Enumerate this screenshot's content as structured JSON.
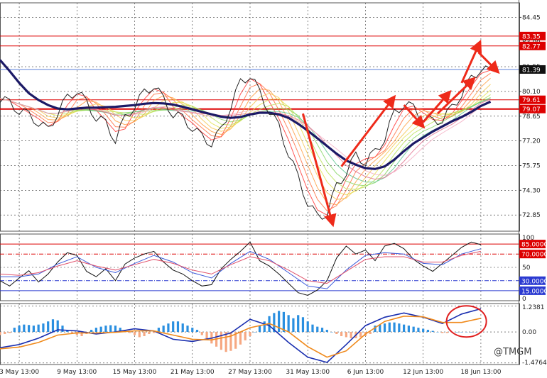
{
  "colors": {
    "background": "#ffffff",
    "grid": "#333333",
    "price_line": "#222222",
    "level_line": "#dd0000",
    "current_line": "#5a7fd8",
    "label_red": "#dd0000",
    "label_dark": "#111111",
    "slow_ma": "#1c1a66",
    "arrow": "#ee2a1a",
    "hist_pos": "#2a8fe0",
    "hist_neg": "#f6a882",
    "macd_line": "#1a2fb0",
    "signal_line": "#f08a1c",
    "rsi_main": "#111111",
    "rsi_blue": "#3b5bdb",
    "rsi_red": "#e0506a",
    "highlight_circle": "#e02020"
  },
  "watermark": "@TMGM",
  "chart_data": [
    {
      "type": "line",
      "panel": "price",
      "ylim": [
        71.9,
        85.3
      ],
      "y_ticks": [
        "84.45",
        "81.55",
        "80.10",
        "78.65",
        "77.20",
        "75.75",
        "74.30",
        "72.85"
      ],
      "x_tick_labels": [
        "3 May 13:00",
        "9 May 13:00",
        "15 May 13:00",
        "21 May 13:00",
        "27 May 13:00",
        "31 May 13:00",
        "6 Jun 13:00",
        "12 Jun 13:00",
        "18 Jun 13:00"
      ],
      "x_range": [
        0,
        100
      ],
      "x_ticks_at": [
        4,
        16,
        28,
        40,
        52,
        64,
        76,
        88,
        100
      ],
      "horizontal_levels": [
        {
          "value": 83.35,
          "label": "83.35",
          "style": "solid",
          "color_key": "level_line"
        },
        {
          "value": 83.0,
          "label": "83.00",
          "style": "none",
          "color_key": "label_dark"
        },
        {
          "value": 82.77,
          "label": "82.77",
          "style": "solid",
          "color_key": "level_line"
        },
        {
          "value": 81.39,
          "label": "81.39",
          "style": "solid",
          "color_key": "current_line",
          "current": true
        },
        {
          "value": 79.61,
          "label": "79.61",
          "style": "solid",
          "color_key": "level_line"
        },
        {
          "value": 79.07,
          "label": "79.07",
          "style": "solid",
          "color_key": "level_line",
          "bold": true
        }
      ],
      "series": [
        {
          "key": "price",
          "x": [
            0,
            2,
            4,
            6,
            8,
            10,
            12,
            14,
            16,
            18,
            20,
            22,
            24,
            26,
            28,
            30,
            32,
            34,
            36,
            38,
            40,
            42,
            44,
            46,
            48,
            50,
            52,
            54,
            56,
            58,
            60,
            62,
            64,
            66,
            68,
            70,
            72,
            74,
            76,
            78,
            80,
            82,
            84,
            86,
            88,
            90,
            92,
            94,
            96,
            98,
            100,
            102
          ],
          "values": [
            79.7,
            79.4,
            79.0,
            78.7,
            78.3,
            77.8,
            78.9,
            79.7,
            80.2,
            79.4,
            78.6,
            78.2,
            77.3,
            78.5,
            79.3,
            80.0,
            80.5,
            79.6,
            78.8,
            78.5,
            78.0,
            77.4,
            77.1,
            77.8,
            79.3,
            80.6,
            81.1,
            80.0,
            79.0,
            78.0,
            76.5,
            75.0,
            73.6,
            72.7,
            73.0,
            74.5,
            75.4,
            76.3,
            76.0,
            76.5,
            77.4,
            78.8,
            79.4,
            79.1,
            78.6,
            78.3,
            78.5,
            79.1,
            80.0,
            80.8,
            81.5,
            81.2
          ]
        },
        {
          "key": "slow_ma",
          "x": [
            0,
            2,
            4,
            6,
            8,
            10,
            12,
            14,
            16,
            18,
            20,
            22,
            24,
            26,
            28,
            30,
            32,
            34,
            36,
            38,
            40,
            42,
            44,
            46,
            48,
            50,
            52,
            54,
            56,
            58,
            60,
            62,
            64,
            66,
            68,
            70,
            72,
            74,
            76,
            78,
            80,
            82,
            84,
            86,
            88,
            90,
            92,
            94,
            96,
            98,
            100,
            102
          ],
          "values": [
            81.95,
            81.3,
            80.6,
            80.0,
            79.6,
            79.3,
            79.1,
            79.05,
            79.1,
            79.15,
            79.15,
            79.18,
            79.2,
            79.25,
            79.3,
            79.38,
            79.42,
            79.4,
            79.33,
            79.2,
            79.05,
            78.9,
            78.76,
            78.62,
            78.55,
            78.6,
            78.75,
            78.85,
            78.85,
            78.75,
            78.55,
            78.2,
            77.8,
            77.35,
            76.9,
            76.45,
            76.05,
            75.8,
            75.6,
            75.55,
            75.7,
            76.1,
            76.6,
            77.05,
            77.4,
            77.75,
            78.05,
            78.35,
            78.6,
            78.9,
            79.25,
            79.5
          ]
        }
      ],
      "ma_ribbon": true,
      "arrows": [
        {
          "from": [
            63,
            78.8
          ],
          "to": [
            69,
            72.5
          ]
        },
        {
          "from": [
            71,
            75.7
          ],
          "to": [
            81.5,
            79.6
          ]
        },
        {
          "from": [
            84,
            79.3
          ],
          "to": [
            87.5,
            78.2
          ]
        },
        {
          "from": [
            88,
            78.3
          ],
          "to": [
            93,
            79.9
          ]
        },
        {
          "from": [
            91,
            78.8
          ],
          "to": [
            98,
            80.7
          ]
        },
        {
          "from": [
            96,
            80.6
          ],
          "to": [
            99.5,
            82.8
          ]
        },
        {
          "from": [
            99.5,
            82.4
          ],
          "to": [
            103,
            81.4
          ]
        }
      ]
    },
    {
      "type": "line",
      "panel": "oscillator",
      "ylim": [
        0,
        100
      ],
      "y_ticks": [
        "100",
        "50",
        "0"
      ],
      "levels": [
        {
          "value": 85,
          "label": "85.0000",
          "style": "solid"
        },
        {
          "value": 70,
          "label": "70.0000",
          "style": "dashdot"
        },
        {
          "value": 30,
          "label": "30.0000",
          "style": "dashdot"
        },
        {
          "value": 15,
          "label": "15.0000",
          "style": "solid"
        }
      ],
      "series": [
        {
          "key": "rsi_main",
          "x": [
            0,
            2,
            4,
            6,
            8,
            10,
            12,
            14,
            16,
            18,
            20,
            22,
            24,
            26,
            28,
            30,
            32,
            34,
            36,
            38,
            40,
            42,
            44,
            46,
            48,
            50,
            52,
            54,
            56,
            58,
            60,
            62,
            64,
            66,
            68,
            70,
            72,
            74,
            76,
            78,
            80,
            82,
            84,
            86,
            88,
            90,
            92,
            94,
            96,
            98,
            100
          ],
          "values": [
            30,
            22,
            34,
            45,
            28,
            40,
            58,
            72,
            68,
            44,
            36,
            48,
            30,
            55,
            64,
            70,
            74,
            58,
            46,
            40,
            30,
            22,
            24,
            48,
            62,
            74,
            88,
            60,
            52,
            40,
            26,
            12,
            8,
            16,
            30,
            64,
            82,
            70,
            76,
            60,
            82,
            86,
            78,
            62,
            52,
            44,
            56,
            68,
            80,
            88,
            84
          ]
        },
        {
          "key": "rsi_blue",
          "x": [
            0,
            4,
            8,
            12,
            16,
            20,
            24,
            28,
            32,
            36,
            40,
            44,
            48,
            52,
            56,
            60,
            64,
            68,
            72,
            76,
            80,
            84,
            88,
            92,
            96,
            100
          ],
          "values": [
            36,
            36,
            40,
            55,
            66,
            50,
            42,
            56,
            68,
            58,
            42,
            34,
            56,
            74,
            62,
            42,
            22,
            18,
            46,
            68,
            72,
            70,
            56,
            54,
            70,
            78
          ]
        },
        {
          "key": "rsi_red",
          "x": [
            0,
            4,
            8,
            12,
            16,
            20,
            24,
            28,
            32,
            36,
            40,
            44,
            48,
            52,
            56,
            60,
            64,
            68,
            72,
            76,
            80,
            84,
            88,
            92,
            96,
            100
          ],
          "values": [
            40,
            38,
            42,
            52,
            60,
            52,
            46,
            54,
            62,
            56,
            46,
            40,
            54,
            66,
            60,
            46,
            30,
            26,
            44,
            62,
            66,
            66,
            58,
            58,
            68,
            74
          ]
        }
      ]
    },
    {
      "type": "bar",
      "panel": "macd",
      "ylim": [
        -1.55,
        1.35
      ],
      "y_ticks": [
        "1.2381",
        "0.00",
        "-1.4764"
      ],
      "histogram": {
        "x": [
          0,
          1,
          2,
          3,
          4,
          5,
          6,
          7,
          8,
          9,
          10,
          11,
          12,
          13,
          14,
          15,
          16,
          17,
          18,
          19,
          20,
          21,
          22,
          23,
          24,
          25,
          26,
          27,
          28,
          29,
          30,
          31,
          32,
          33,
          34,
          35,
          36,
          37,
          38,
          39,
          40,
          41,
          42,
          43,
          44,
          45,
          46,
          47,
          48,
          49,
          50,
          51,
          52,
          53,
          54,
          55,
          56,
          57,
          58,
          59,
          60,
          61,
          62,
          63,
          64,
          65,
          66,
          67,
          68,
          69,
          70,
          71,
          72,
          73,
          74,
          75,
          76,
          77,
          78,
          79,
          80,
          81,
          82,
          83,
          84,
          85,
          86,
          87,
          88,
          89,
          90,
          91,
          92,
          93,
          94,
          95,
          96,
          97,
          98,
          99
        ],
        "values": [
          -0.15,
          -0.1,
          -0.05,
          0.2,
          0.3,
          0.35,
          0.33,
          0.3,
          0.35,
          0.4,
          0.5,
          0.6,
          0.55,
          0.3,
          0.1,
          -0.05,
          -0.15,
          -0.2,
          -0.1,
          0.1,
          0.2,
          0.25,
          0.3,
          0.32,
          0.3,
          0.2,
          0.1,
          -0.05,
          -0.15,
          -0.25,
          -0.2,
          -0.1,
          -0.05,
          0.2,
          0.3,
          0.4,
          0.5,
          0.5,
          0.4,
          0.3,
          0.2,
          0.1,
          -0.15,
          -0.35,
          -0.55,
          -0.7,
          -0.85,
          -0.95,
          -0.9,
          -0.8,
          -0.6,
          -0.4,
          -0.2,
          0.0,
          0.3,
          0.5,
          0.75,
          0.9,
          1.0,
          0.95,
          0.8,
          0.65,
          0.8,
          0.7,
          0.5,
          0.35,
          0.25,
          0.2,
          0.1,
          0.0,
          -0.1,
          -0.2,
          -0.25,
          -0.3,
          -0.3,
          -0.25,
          -0.2,
          -0.1,
          0.3,
          0.35,
          0.4,
          0.45,
          0.45,
          0.4,
          0.35,
          0.3,
          0.25,
          0.2,
          0.15,
          0.1,
          0.05,
          0.0,
          -0.05,
          -0.05,
          0.0,
          0.0,
          0.0,
          0.0,
          0.0,
          0.0
        ]
      },
      "series": [
        {
          "key": "macd_line",
          "x": [
            0,
            4,
            8,
            12,
            16,
            20,
            24,
            28,
            32,
            36,
            40,
            44,
            48,
            52,
            56,
            60,
            64,
            68,
            72,
            76,
            80,
            84,
            88,
            92,
            96,
            100
          ],
          "values": [
            -0.75,
            -0.6,
            -0.3,
            0.1,
            0.05,
            -0.1,
            0.0,
            0.15,
            0.05,
            -0.35,
            -0.45,
            -0.3,
            -0.05,
            0.6,
            0.3,
            -0.5,
            -1.2,
            -1.45,
            -0.6,
            0.3,
            0.7,
            0.9,
            0.7,
            0.4,
            0.85,
            1.1
          ]
        },
        {
          "key": "signal_line",
          "x": [
            0,
            4,
            8,
            12,
            16,
            20,
            24,
            28,
            32,
            36,
            40,
            44,
            48,
            52,
            56,
            60,
            64,
            68,
            72,
            76,
            80,
            84,
            88,
            92,
            96,
            100
          ],
          "values": [
            -0.8,
            -0.72,
            -0.5,
            -0.15,
            -0.05,
            -0.05,
            -0.02,
            0.05,
            0.05,
            -0.15,
            -0.35,
            -0.38,
            -0.2,
            0.2,
            0.4,
            0.0,
            -0.7,
            -1.2,
            -0.9,
            -0.1,
            0.5,
            0.75,
            0.72,
            0.45,
            0.45,
            0.65
          ]
        }
      ],
      "highlight": {
        "x": 97,
        "y": 0.5
      }
    }
  ]
}
